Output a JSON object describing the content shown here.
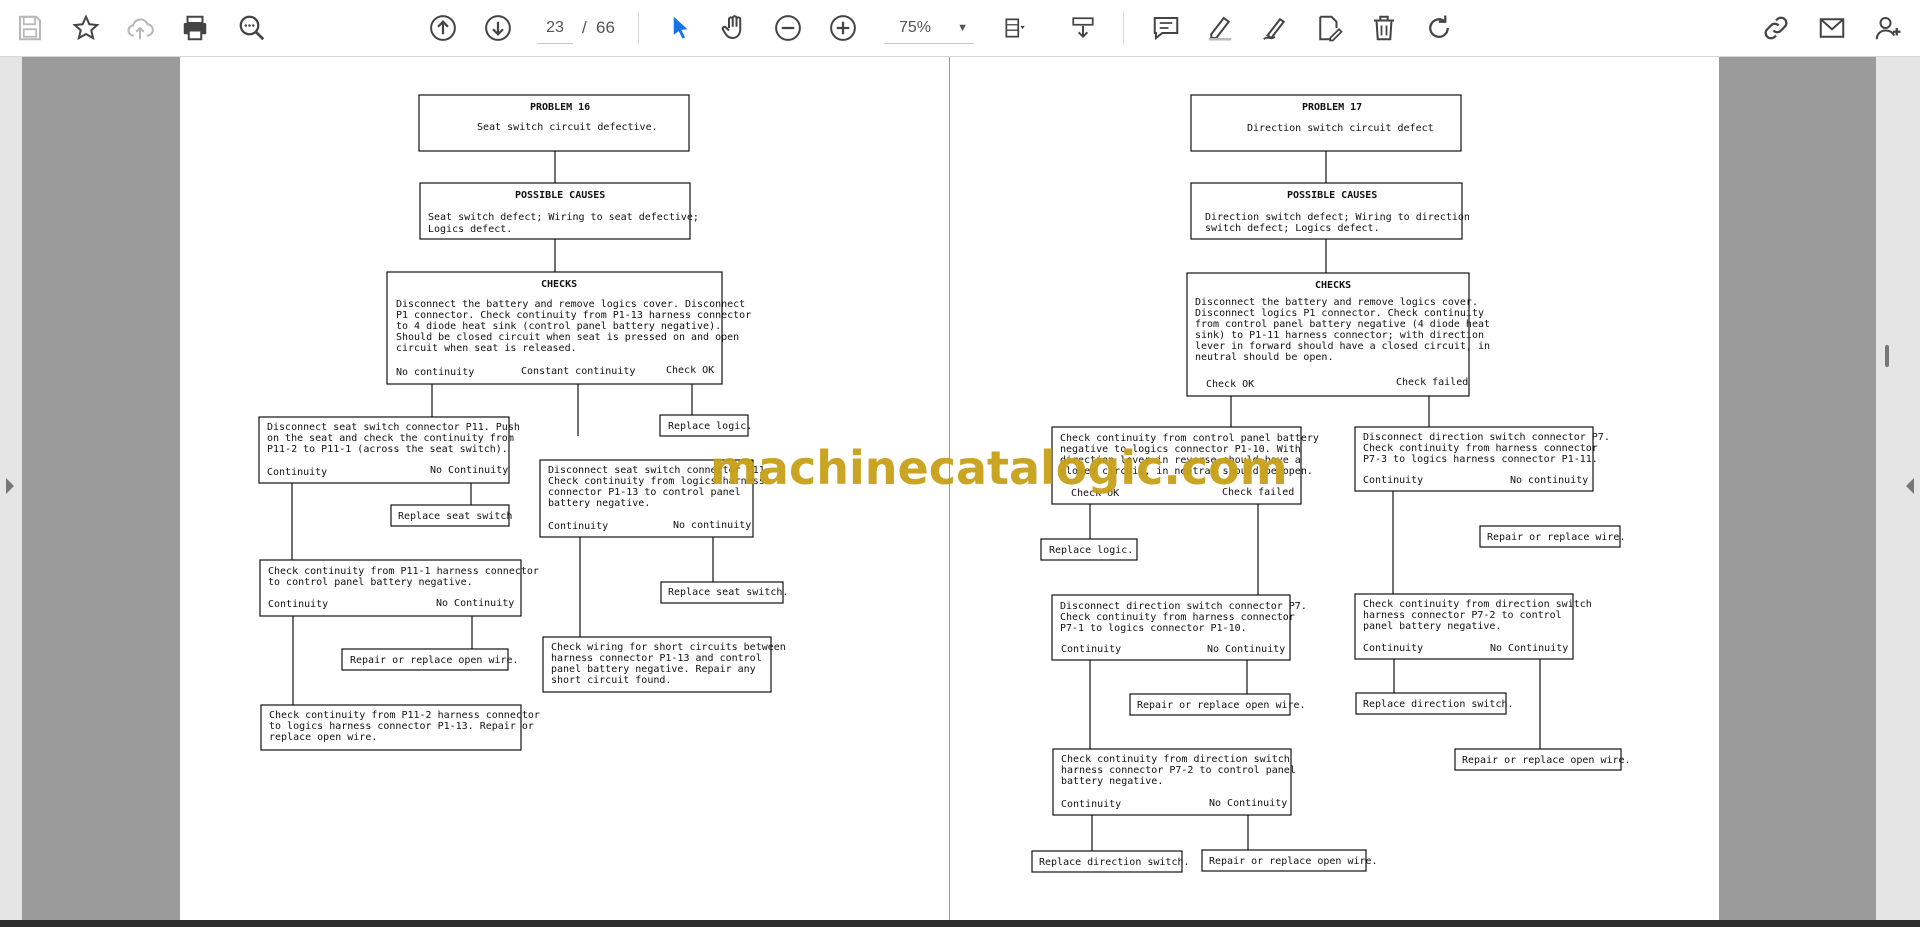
{
  "toolbar": {
    "current_page": "23",
    "page_separator": "/",
    "total_pages": "66",
    "zoom": "75%",
    "icons": [
      "save-icon",
      "bookmark-star-icon",
      "cloud-upload-icon",
      "print-icon",
      "find-zoom-icon",
      "page-up-icon",
      "page-down-icon",
      "select-cursor-icon",
      "hand-pan-icon",
      "zoom-out-icon",
      "zoom-in-icon",
      "fit-page-icon",
      "scroll-mode-icon",
      "comment-icon",
      "highlight-pen-icon",
      "draw-sign-icon",
      "fill-sign-icon",
      "delete-icon",
      "rotate-icon",
      "share-link-icon",
      "email-icon",
      "add-user-icon"
    ]
  },
  "watermark": "machinecatalogic.com",
  "left_page": {
    "problem_title": "PROBLEM 16",
    "problem_desc": "Seat switch circuit defective.",
    "causes_title": "POSSIBLE CAUSES",
    "causes": [
      "Seat switch defect; Wiring to seat defective;",
      "Logics defect."
    ],
    "checks_title": "CHECKS",
    "checks": [
      "Disconnect the battery and remove logics cover. Disconnect",
      "P1 connector.  Check continuity from P1-13 harness connector",
      "to 4 diode heat sink (control panel battery negative).",
      "Should be closed circuit when seat is pressed on and open",
      "circuit when seat is released."
    ],
    "branch_no": "No continuity",
    "branch_const": "Constant continuity",
    "branch_ok": "Check OK",
    "replace_logic": "Replace logic.",
    "disc_seat": [
      "Disconnect seat switch connector P11.  Push",
      "on the seat and check the continuity from",
      "P11-2 to P11-1 (across the seat switch)."
    ],
    "cont": "Continuity",
    "nocont": "No Continuity",
    "nocont_lc": "No continuity",
    "replace_seat": "Replace seat switch",
    "replace_seat2": "Replace seat switch.",
    "disc_logics": [
      "Disconnect seat switch connector P11.",
      "Check continuity from logics harness",
      "connector P1-13 to control panel",
      "battery negative."
    ],
    "check_p11_1": [
      "Check continuity from P11-1 harness connector",
      "to control panel battery negative."
    ],
    "repair_open": "Repair or replace open wire.",
    "check_short": [
      "Check wiring for short circuits between",
      "harness connector P1-13 and control",
      "panel battery negative.  Repair any",
      "short circuit found."
    ],
    "check_p11_2": [
      "Check continuity from P11-2 harness connector",
      "to logics harness connector P1-13.  Repair or",
      "replace open wire."
    ]
  },
  "right_page": {
    "problem_title": "PROBLEM 17",
    "problem_desc": "Direction switch circuit defect",
    "causes_title": "POSSIBLE CAUSES",
    "causes": [
      "Direction switch defect; Wiring to direction",
      "switch defect; Logics defect."
    ],
    "checks_title": "CHECKS",
    "checks": [
      "Disconnect the battery and remove logics cover.",
      "Disconnect logics P1 connector.  Check continuity",
      "from control panel battery negative (4 diode heat",
      "sink) to P1-11 harness connector; with direction",
      "lever in forward should have a closed circuit, in",
      "neutral should be open."
    ],
    "check_ok": "Check OK",
    "check_failed": "Check failed",
    "check_p1_10": [
      "Check continuity from control panel battery",
      "negative to logics connector P1-10.  With",
      "direction lever in reverse should have a",
      "closed circuit, in neutral should be open."
    ],
    "disc_p7_a": [
      "Disconnect direction switch connector P7.",
      "Check continuity from harness connector",
      "P7-3 to logics harness connector P1-11."
    ],
    "cont": "Continuity",
    "nocont": "No Continuity",
    "nocont_lc": "No continuity",
    "replace_logic": "Replace logic.",
    "repair_wire": "Repair or replace wire.",
    "disc_p7_b": [
      "Disconnect direction switch connector P7.",
      "Check continuity from harness connector",
      "P7-1 to logics connector P1-10."
    ],
    "check_p7_2_right": [
      "Check continuity from direction switch",
      "harness connector P7-2 to control",
      "panel battery negative."
    ],
    "repair_open": "Repair or replace open wire.",
    "replace_dir": "Replace direction switch.",
    "check_p7_2_left": [
      "Check continuity from direction switch",
      "harness connector P7-2 to control panel",
      "battery negative."
    ],
    "repair_open2": "Repair or replace open wire."
  }
}
